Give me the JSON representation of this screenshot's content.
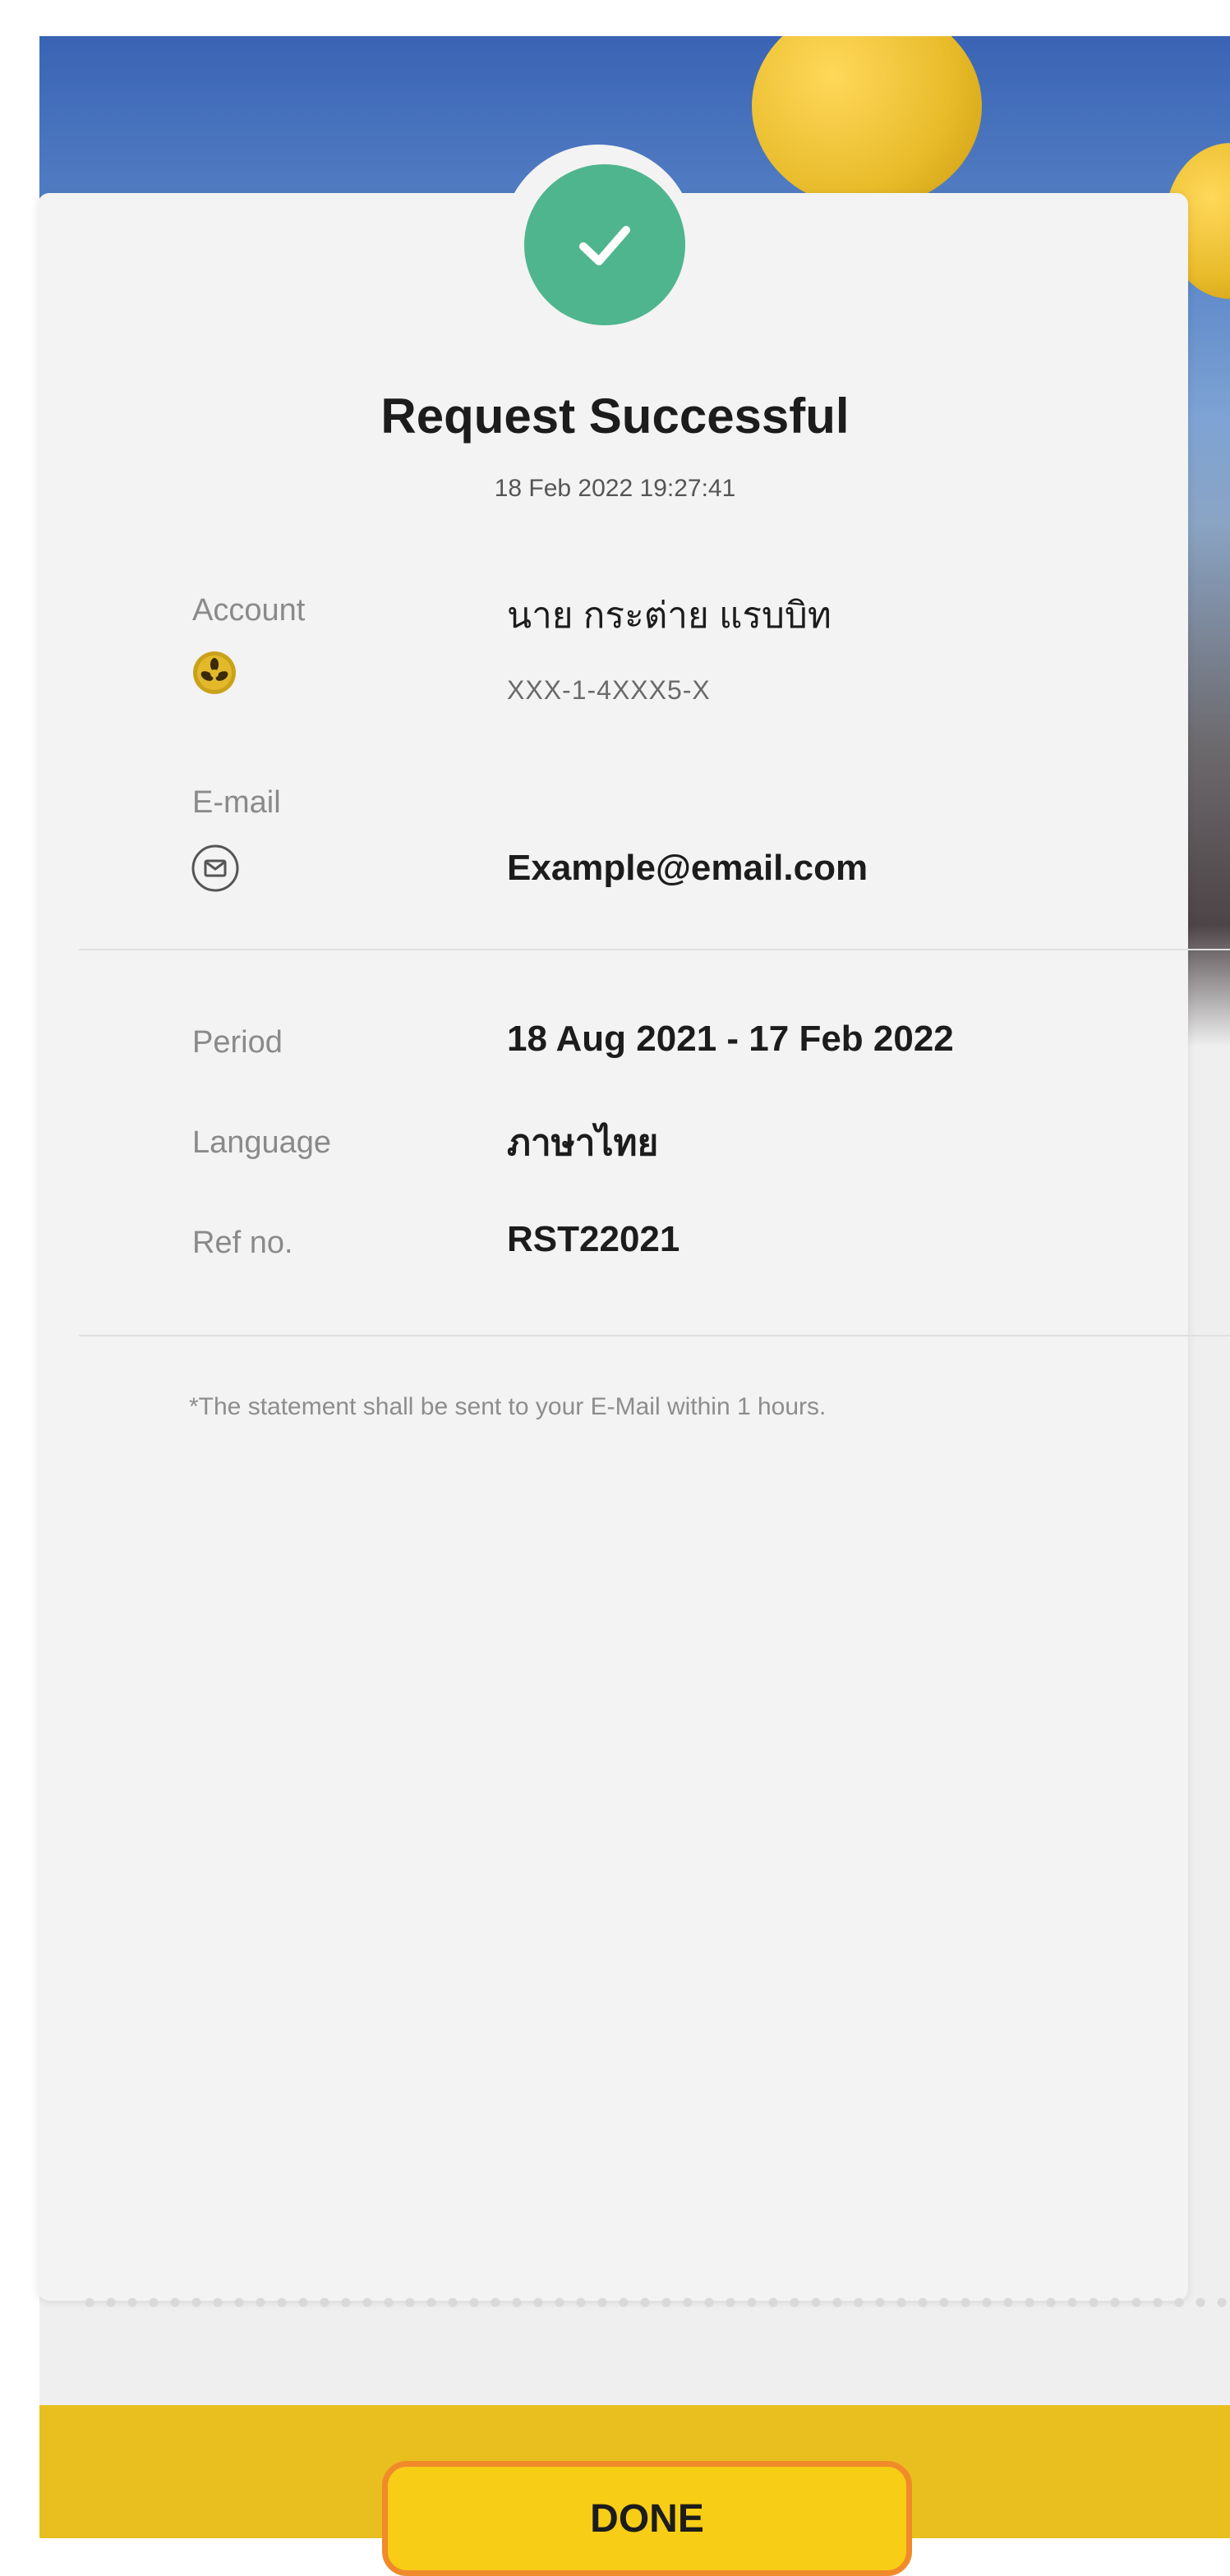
{
  "header": {
    "title": "Request Successful",
    "timestamp": "18 Feb 2022 19:27:41"
  },
  "account": {
    "label": "Account",
    "name": "นาย กระต่าย แรบบิท",
    "number": "XXX-1-4XXX5-X",
    "icon": "bank-logo-icon"
  },
  "email": {
    "label": "E-mail",
    "value": "Example@email.com",
    "icon": "mail-icon"
  },
  "details": {
    "period_label": "Period",
    "period_value": "18 Aug 2021 - 17 Feb 2022",
    "language_label": "Language",
    "language_value": "ภาษาไทย",
    "ref_label": "Ref no.",
    "ref_value": "RST22021"
  },
  "note": "*The statement shall be sent to your E-Mail within 1 hours.",
  "footer": {
    "done_label": "DONE"
  },
  "colors": {
    "success": "#4fb58e",
    "accent": "#f8cd16",
    "highlight": "#f08a2a"
  }
}
